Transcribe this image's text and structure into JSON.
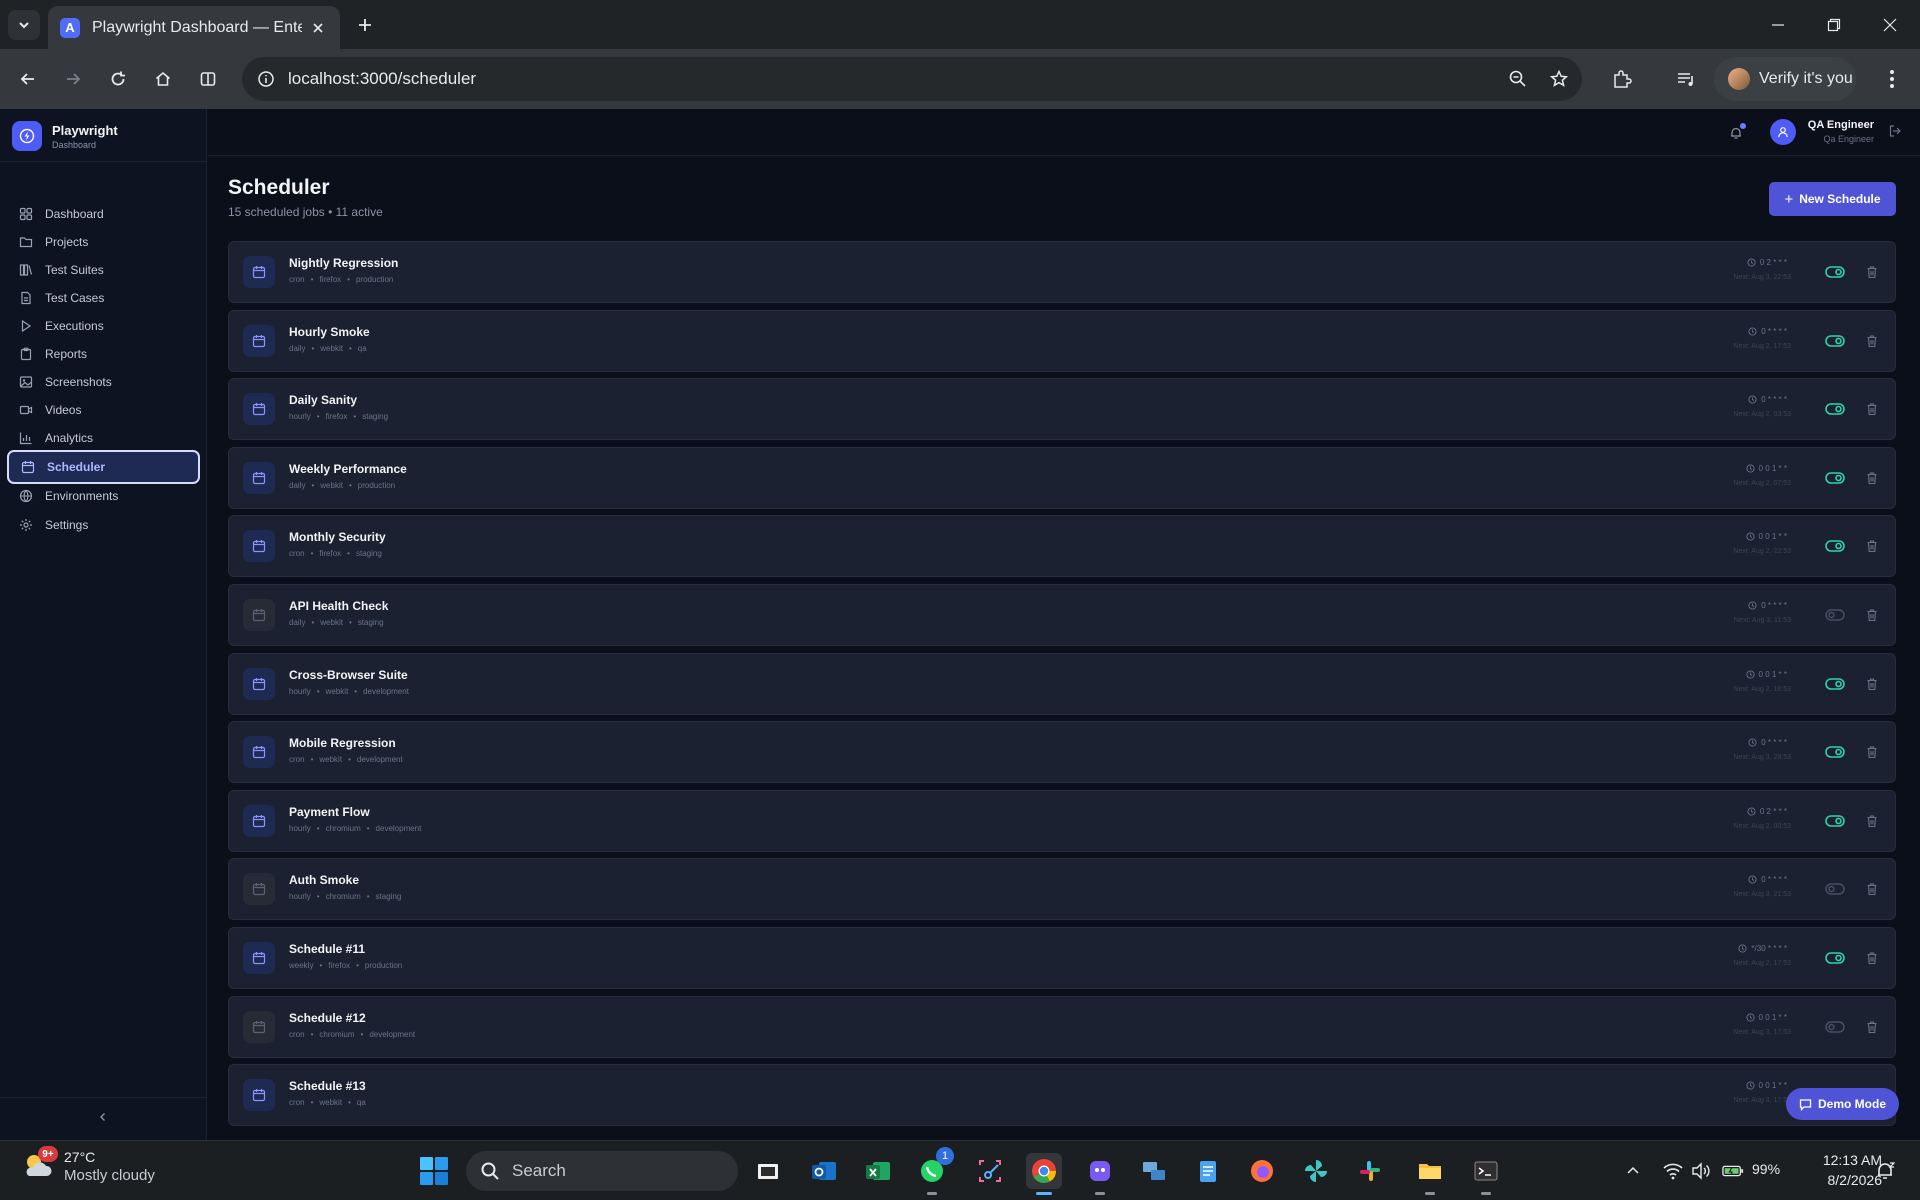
{
  "browser": {
    "tab_title": "Playwright Dashboard — Enterprise",
    "favicon_letter": "A",
    "url": "localhost:3000/scheduler",
    "profile_button": "Verify it's you"
  },
  "sidebar": {
    "brand_name": "Playwright",
    "brand_sub": "Dashboard",
    "items": [
      {
        "label": "Dashboard",
        "icon": "grid-icon"
      },
      {
        "label": "Projects",
        "icon": "folder-icon"
      },
      {
        "label": "Test Suites",
        "icon": "columns-icon"
      },
      {
        "label": "Test Cases",
        "icon": "file-icon"
      },
      {
        "label": "Executions",
        "icon": "play-icon"
      },
      {
        "label": "Reports",
        "icon": "clipboard-icon"
      },
      {
        "label": "Screenshots",
        "icon": "image-icon"
      },
      {
        "label": "Videos",
        "icon": "video-icon"
      },
      {
        "label": "Analytics",
        "icon": "bar-chart-icon"
      },
      {
        "label": "Scheduler",
        "icon": "calendar-icon",
        "active": true
      },
      {
        "label": "Environments",
        "icon": "globe-icon"
      },
      {
        "label": "Settings",
        "icon": "gear-icon"
      }
    ]
  },
  "header": {
    "user_name": "QA Engineer",
    "user_role": "Qa Engineer"
  },
  "page": {
    "title": "Scheduler",
    "subtitle": "15 scheduled jobs • 11 active",
    "new_button": "New Schedule",
    "demo_button": "Demo Mode"
  },
  "schedules": [
    {
      "name": "Nightly Regression",
      "type": "cron",
      "browser": "firefox",
      "env": "production",
      "cron": "0 2 * * *",
      "next": "Next: Aug 3, 22:53",
      "active": true
    },
    {
      "name": "Hourly Smoke",
      "type": "daily",
      "browser": "webkit",
      "env": "qa",
      "cron": "0 * * * *",
      "next": "Next: Aug 2, 17:53",
      "active": true
    },
    {
      "name": "Daily Sanity",
      "type": "hourly",
      "browser": "firefox",
      "env": "staging",
      "cron": "0 * * * *",
      "next": "Next: Aug 2, 03:53",
      "active": true
    },
    {
      "name": "Weekly Performance",
      "type": "daily",
      "browser": "webkit",
      "env": "production",
      "cron": "0 0 1 * *",
      "next": "Next: Aug 2, 07:53",
      "active": true
    },
    {
      "name": "Monthly Security",
      "type": "cron",
      "browser": "firefox",
      "env": "staging",
      "cron": "0 0 1 * *",
      "next": "Next: Aug 2, 22:53",
      "active": true
    },
    {
      "name": "API Health Check",
      "type": "daily",
      "browser": "webkit",
      "env": "staging",
      "cron": "0 * * * *",
      "next": "Next: Aug 3, 11:53",
      "active": false
    },
    {
      "name": "Cross-Browser Suite",
      "type": "hourly",
      "browser": "webkit",
      "env": "development",
      "cron": "0 0 1 * *",
      "next": "Next: Aug 2, 18:53",
      "active": true
    },
    {
      "name": "Mobile Regression",
      "type": "cron",
      "browser": "webkit",
      "env": "development",
      "cron": "0 * * * *",
      "next": "Next: Aug 3, 23:53",
      "active": true
    },
    {
      "name": "Payment Flow",
      "type": "hourly",
      "browser": "chromium",
      "env": "development",
      "cron": "0 2 * * *",
      "next": "Next: Aug 2, 00:53",
      "active": true
    },
    {
      "name": "Auth Smoke",
      "type": "hourly",
      "browser": "chromium",
      "env": "staging",
      "cron": "0 * * * *",
      "next": "Next: Aug 3, 21:53",
      "active": false
    },
    {
      "name": "Schedule #11",
      "type": "weekly",
      "browser": "firefox",
      "env": "production",
      "cron": "*/30 * * * *",
      "next": "Next: Aug 2, 17:53",
      "active": true
    },
    {
      "name": "Schedule #12",
      "type": "cron",
      "browser": "chromium",
      "env": "development",
      "cron": "0 0 1 * *",
      "next": "Next: Aug 3, 17:53",
      "active": false
    },
    {
      "name": "Schedule #13",
      "type": "cron",
      "browser": "webkit",
      "env": "qa",
      "cron": "0 0 1 * *",
      "next": "Next: Aug 3, 17:53",
      "active": true
    }
  ],
  "taskbar": {
    "weather_badge": "9+",
    "temperature": "27°C",
    "condition": "Mostly cloudy",
    "search_placeholder": "Search",
    "whatsapp_badge": "1",
    "battery": "99%",
    "time": "12:13 AM",
    "date": "8/2/2026"
  },
  "colors": {
    "accent": "#4f54d6",
    "toggle_on": "#2dd4a7",
    "app_bg": "#0b0f1a",
    "row_bg": "#1b2130"
  }
}
